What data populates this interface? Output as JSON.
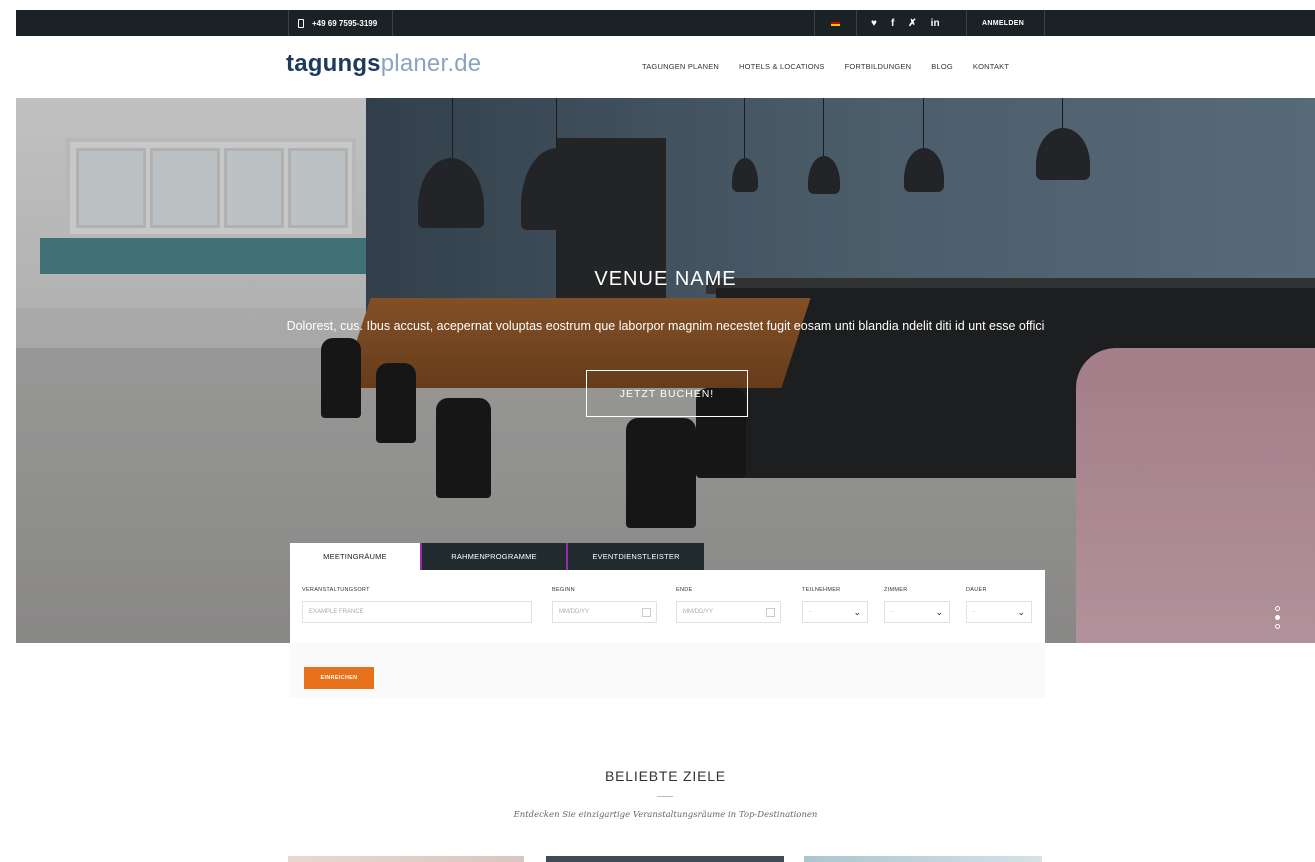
{
  "topbar": {
    "phone": "+49 69 7595-3199",
    "social_icons": [
      "twitter-icon",
      "facebook-icon",
      "xing-icon",
      "linkedin-icon"
    ],
    "social_glyphs": {
      "twitter": "♥",
      "facebook": "f",
      "xing": "✗",
      "linkedin": "in"
    },
    "login_label": "ANMELDEN",
    "colors": {
      "background": "#1b2226"
    }
  },
  "header": {
    "logo_part1": "tagungs",
    "logo_part2": "planer.de",
    "nav": [
      "TAGUNGEN PLANEN",
      "HOTELS & LOCATIONS",
      "FORTBILDUNGEN",
      "BLOG",
      "KONTAKT"
    ]
  },
  "hero": {
    "title": "VENUE NAME",
    "subtitle": "Dolorest, cus. Ibus accust, acepernat voluptas eostrum que laborpor magnim necestet fugit eosam unti blandia ndelit diti id unt esse offici",
    "button_label": "JETZT BUCHEN!",
    "slides_total": 3,
    "active_slide": 2
  },
  "search": {
    "tabs": [
      "MEETINGRÄUME",
      "RAHMENPROGRAMME",
      "EVENTDIENSTLEISTER"
    ],
    "active_tab": 0,
    "fields": {
      "ort_label": "VERANSTALTUNGSORT",
      "ort_placeholder": "EXAMPLE FRANCE",
      "beginn_label": "BEGINN",
      "beginn_placeholder": "MM/DD/YY",
      "ende_label": "ENDE",
      "ende_placeholder": "MM/DD/YY",
      "teilnehmer_label": "TEILNEHMER",
      "teilnehmer_value": "-",
      "zimmer_label": "ZIMMER",
      "zimmer_value": "-",
      "dauer_label": "DAUER",
      "dauer_value": "-"
    },
    "submit_label": "EINREICHEN",
    "colors": {
      "submit": "#e8721b",
      "tab_accent": "#9b2ca8"
    }
  },
  "section": {
    "title": "BELIEBTE ZIELE",
    "subtitle": "Entdecken Sie einzigartige Veranstaltungsräume in Top-Destinationen"
  }
}
